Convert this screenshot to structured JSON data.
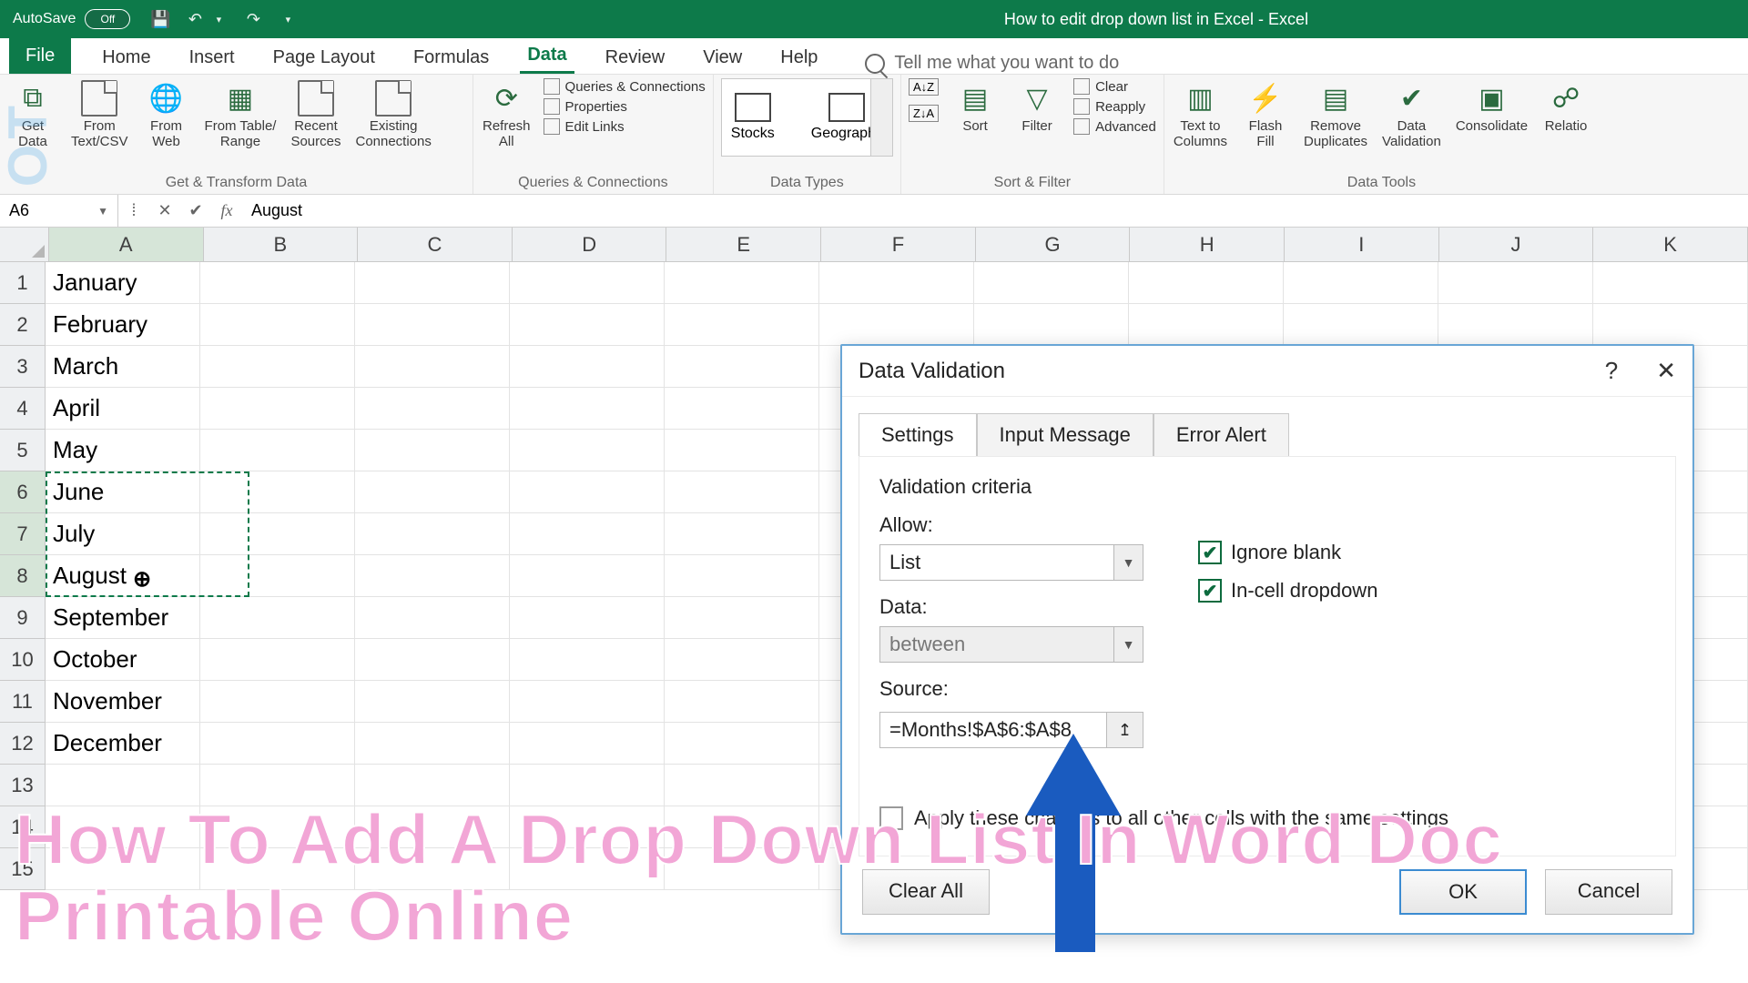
{
  "title_bar": {
    "autosave_label": "AutoSave",
    "autosave_state": "Off",
    "doc_title": "How to edit drop down list in Excel  -  Excel"
  },
  "menu": {
    "file": "File",
    "tabs": [
      "Home",
      "Insert",
      "Page Layout",
      "Formulas",
      "Data",
      "Review",
      "View",
      "Help"
    ],
    "active": "Data",
    "tell_me": "Tell me what you want to do"
  },
  "ribbon": {
    "g1": {
      "label": "Get & Transform Data",
      "buttons": [
        "Get\nData",
        "From\nText/CSV",
        "From\nWeb",
        "From Table/\nRange",
        "Recent\nSources",
        "Existing\nConnections"
      ]
    },
    "g2": {
      "label": "Queries & Connections",
      "refresh": "Refresh\nAll",
      "links": [
        "Queries & Connections",
        "Properties",
        "Edit Links"
      ]
    },
    "g3": {
      "label": "Data Types",
      "items": [
        "Stocks",
        "Geography"
      ]
    },
    "g4": {
      "label": "Sort & Filter",
      "sort": "Sort",
      "filter": "Filter",
      "links": [
        "Clear",
        "Reapply",
        "Advanced"
      ]
    },
    "g5": {
      "label": "Data Tools",
      "buttons": [
        "Text to\nColumns",
        "Flash\nFill",
        "Remove\nDuplicates",
        "Data\nValidation",
        "Consolidate",
        "Relatio"
      ]
    }
  },
  "formula_bar": {
    "cell_ref": "A6",
    "formula": "August"
  },
  "sheet": {
    "columns": [
      "A",
      "B",
      "C",
      "D",
      "E",
      "F",
      "G",
      "H",
      "I",
      "J",
      "K"
    ],
    "rows": [
      1,
      2,
      3,
      4,
      5,
      6,
      7,
      8,
      9,
      10,
      11,
      12,
      13,
      14,
      15
    ],
    "col_a": [
      "January",
      "February",
      "March",
      "April",
      "May",
      "June",
      "July",
      "August",
      "September",
      "October",
      "November",
      "December",
      "",
      "",
      ""
    ],
    "selected_col": "A",
    "selected_rows": [
      6,
      7,
      8
    ],
    "active_cell_display": "August↔"
  },
  "dialog": {
    "title": "Data Validation",
    "tabs": [
      "Settings",
      "Input Message",
      "Error Alert"
    ],
    "active_tab": "Settings",
    "criteria_label": "Validation criteria",
    "allow_label": "Allow:",
    "allow_value": "List",
    "data_label": "Data:",
    "data_value": "between",
    "ignore_blank": "Ignore blank",
    "incell_dropdown": "In-cell dropdown",
    "source_label": "Source:",
    "source_value": "=Months!$A$6:$A$8",
    "apply_label": "Apply these changes to all other cells with the same settings",
    "clear_all": "Clear All",
    "ok": "OK",
    "cancel": "Cancel"
  },
  "overlay": {
    "line1": "How To Add A Drop Down List In Word Doc",
    "line2": "Printable Online"
  }
}
